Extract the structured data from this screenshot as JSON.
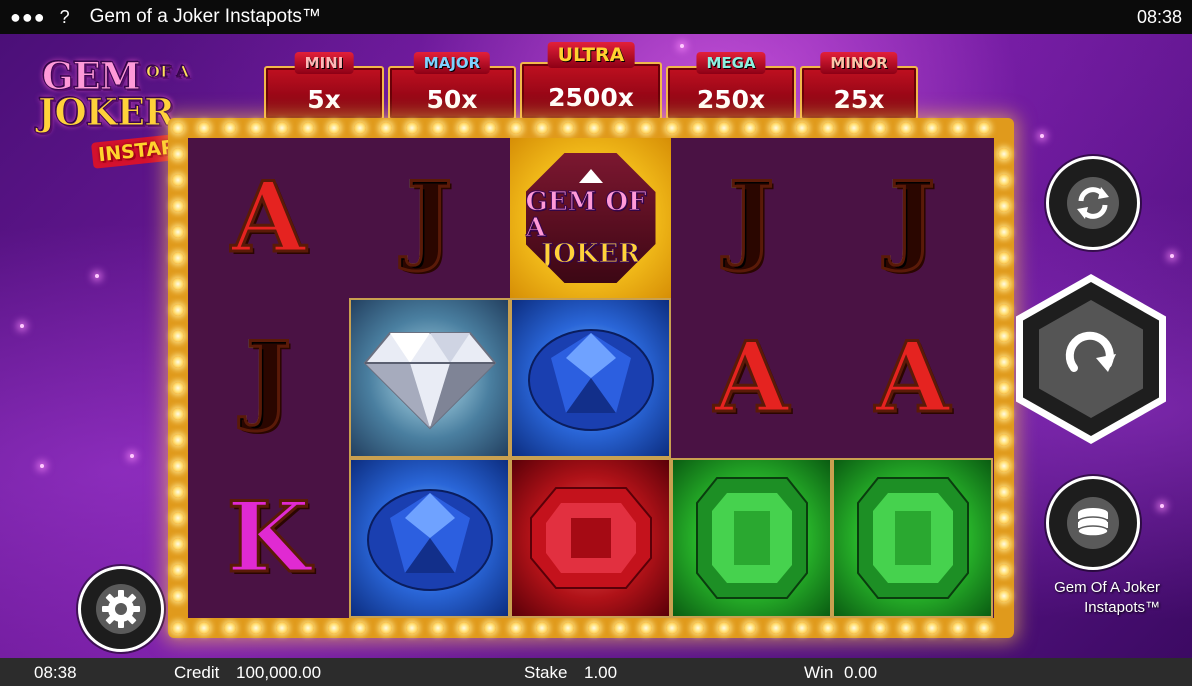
{
  "topbar": {
    "menu_icon": "●●●",
    "help_icon": "?",
    "title": "Gem of a Joker Instapots™",
    "time": "08:38"
  },
  "logo": {
    "line1": "GEM",
    "line1b": "OF A",
    "line2": "JOKER",
    "line3": "INSTAPOTS"
  },
  "jackpots": [
    {
      "name": "MINI",
      "value": "5x"
    },
    {
      "name": "MAJOR",
      "value": "50x"
    },
    {
      "name": "ULTRA",
      "value": "2500x"
    },
    {
      "name": "MEGA",
      "value": "250x"
    },
    {
      "name": "MINOR",
      "value": "25x"
    }
  ],
  "reels": {
    "row1": [
      {
        "symbol": "A",
        "type": "letter-A"
      },
      {
        "symbol": "J",
        "type": "letter-J"
      },
      {
        "symbol": "joker-gem",
        "type": "joker",
        "text1": "GEM OF A",
        "text2": "JOKER"
      },
      {
        "symbol": "J",
        "type": "letter-J"
      },
      {
        "symbol": "J",
        "type": "letter-J"
      }
    ],
    "row2": [
      {
        "symbol": "J",
        "type": "letter-J"
      },
      {
        "symbol": "white-diamond",
        "type": "gem-white"
      },
      {
        "symbol": "blue-sapphire",
        "type": "gem-blue"
      },
      {
        "symbol": "A",
        "type": "letter-A"
      },
      {
        "symbol": "A",
        "type": "letter-A"
      }
    ],
    "row3": [
      {
        "symbol": "K",
        "type": "letter-K"
      },
      {
        "symbol": "blue-sapphire",
        "type": "gem-blue"
      },
      {
        "symbol": "red-ruby",
        "type": "gem-red"
      },
      {
        "symbol": "green-emerald",
        "type": "gem-green"
      },
      {
        "symbol": "green-emerald",
        "type": "gem-green"
      }
    ]
  },
  "buttons": {
    "autoplay_icon": "autoplay-icon",
    "spin_icon": "spin-icon",
    "stake_icon": "coin-stack-icon",
    "settings_icon": "gear-icon"
  },
  "game_name": {
    "line1": "Gem Of A Joker",
    "line2": "Instapots™"
  },
  "bottombar": {
    "time": "08:38",
    "credit_label": "Credit",
    "credit_value": "100,000.00",
    "stake_label": "Stake",
    "stake_value": "1.00",
    "win_label": "Win",
    "win_value": "0.00"
  }
}
